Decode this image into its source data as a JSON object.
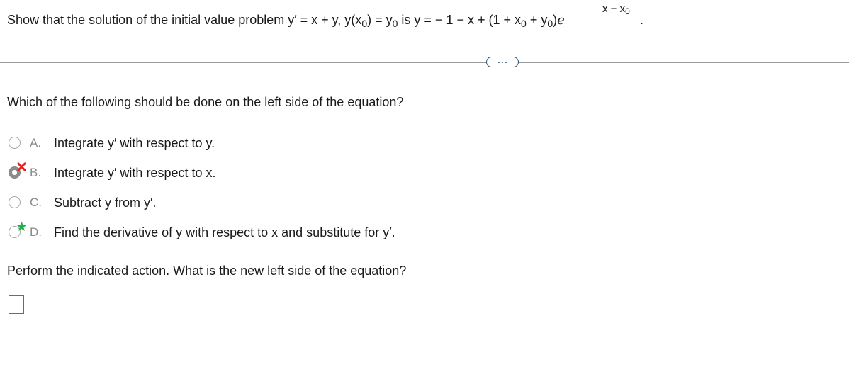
{
  "problem": {
    "part1": "Show that the solution of the initial value problem y′ = x + y, y(x",
    "sub1": "0",
    "part2": ") = y",
    "sub2": "0",
    "part3": " is y = − 1 − x + (1 + x",
    "sub3": "0",
    "part4": " + y",
    "sub4": "0",
    "part5": ")",
    "e": "e",
    "exp_main": "x − x",
    "exp_sub": "0",
    "period": "."
  },
  "more_button": {
    "label": "More"
  },
  "question": "Which of the following should be done on the left side of the equation?",
  "options": [
    {
      "letter": "A.",
      "text": "Integrate y′ with respect to y.",
      "state": "unselected"
    },
    {
      "letter": "B.",
      "text": "Integrate y′ with respect to x.",
      "state": "selected-incorrect"
    },
    {
      "letter": "C.",
      "text": "Subtract y from y′.",
      "state": "unselected"
    },
    {
      "letter": "D.",
      "text": "Find the derivative of y with respect to x and substitute for y′.",
      "state": "correct-answer"
    }
  ],
  "answer_prompt": "Perform the indicated action. What is the new left side of the equation?",
  "answer_input": {
    "value": ""
  },
  "colors": {
    "incorrect_mark": "#e02020",
    "correct_mark": "#22b14c",
    "link_border": "#2e4a78"
  }
}
